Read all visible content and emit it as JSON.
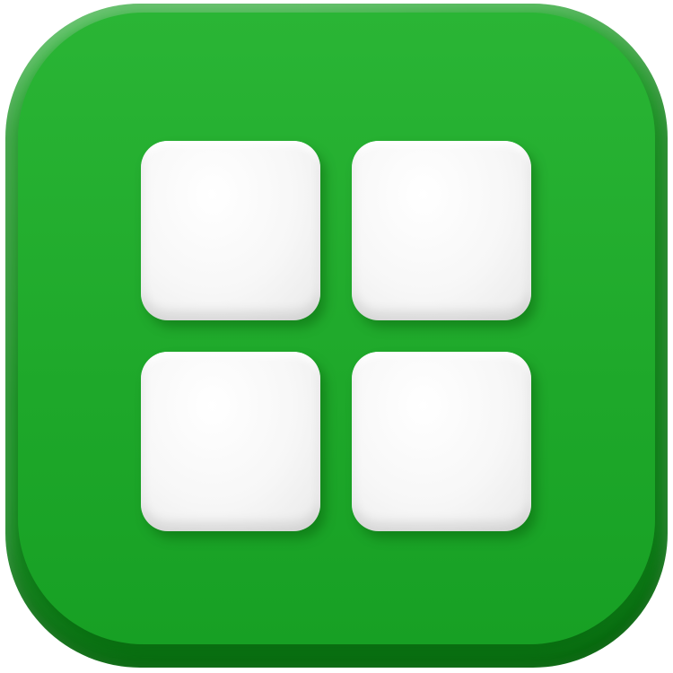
{
  "icon": {
    "name": "app-grid-icon",
    "tiles": [
      "tile",
      "tile",
      "tile",
      "tile"
    ]
  },
  "colors": {
    "tile_green": "#1fa52a",
    "cell_white": "#f5f5f5"
  }
}
